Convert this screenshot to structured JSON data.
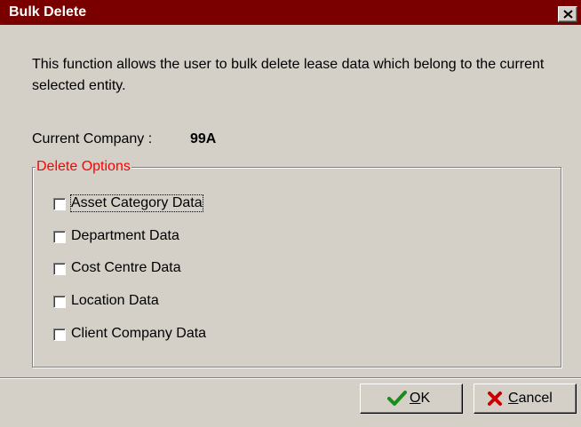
{
  "window": {
    "title": "Bulk Delete",
    "close_symbol": "✕"
  },
  "intro": {
    "text": "This function allows the user to bulk delete lease data which belong to the current selected entity."
  },
  "company": {
    "label": "Current Company :",
    "value": "99A"
  },
  "delete_options": {
    "legend": "Delete Options",
    "items": [
      {
        "label": "Asset Category Data",
        "checked": false
      },
      {
        "label": "Department Data",
        "checked": false
      },
      {
        "label": "Cost Centre Data",
        "checked": false
      },
      {
        "label": "Location Data",
        "checked": false
      },
      {
        "label": "Client Company Data",
        "checked": false
      }
    ]
  },
  "buttons": {
    "ok": {
      "mnemonic": "O",
      "rest": "K",
      "icon": "checkmark-icon"
    },
    "cancel": {
      "mnemonic": "C",
      "rest": "ancel",
      "icon": "x-icon"
    }
  },
  "colors": {
    "titlebar": "#7a0000",
    "legend": "#ff0000",
    "ok_icon": "#1a8c1a",
    "cancel_icon": "#cc0000"
  }
}
